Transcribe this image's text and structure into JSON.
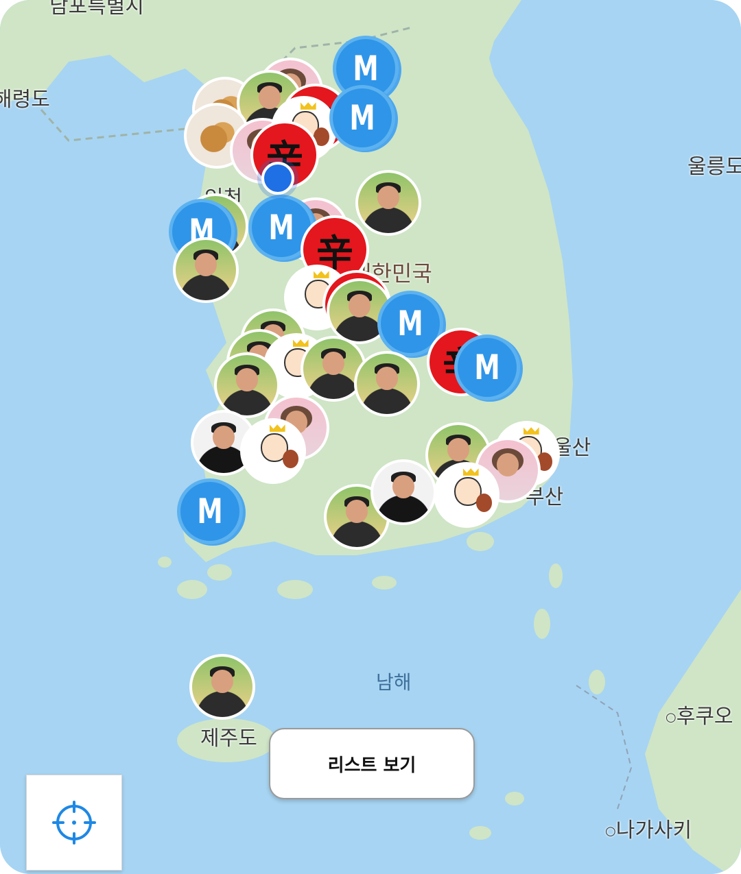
{
  "map": {
    "place_labels": {
      "pyongyang_cut": "남포특별시",
      "hwanghae_cut": "해령도",
      "incheon": "인천",
      "korea": "대한민국",
      "ulsan": "울산",
      "busan": "부산",
      "ulleung_cut": "울릉도",
      "jeju": "제주도",
      "south_sea": "남해",
      "fukuoka_cut": "후쿠오",
      "nagasaki": "나가사키"
    },
    "marker_text": {
      "m_letter": "M",
      "red_glyph": "辛"
    },
    "colors": {
      "sea": "#a7d4f2",
      "land": "#cfe5c6",
      "marker_blue": "#2f95e8",
      "marker_red": "#e3171d",
      "user_location": "#1f6fe5"
    }
  },
  "controls": {
    "list_button_label": "리스트 보기",
    "locate_icon": "crosshair-icon"
  }
}
